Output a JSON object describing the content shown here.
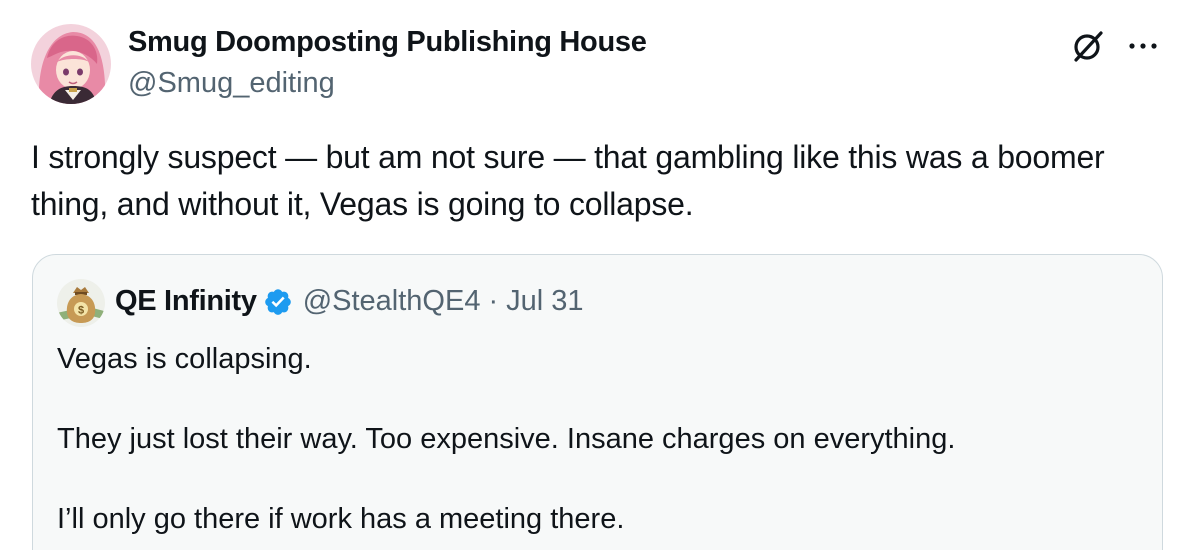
{
  "tweet": {
    "author": {
      "display_name": "Smug Doomposting Publishing House",
      "handle": "@Smug_editing",
      "avatar": "anime-character-avatar"
    },
    "icons": {
      "grok": "grok-slash-icon",
      "more": "more-dots-icon"
    },
    "text": "I strongly suspect — but am not sure — that gambling like this was a boomer thing, and without it, Vegas is going to collapse."
  },
  "quoted_tweet": {
    "author": {
      "display_name": "QE Infinity",
      "handle": "@StealthQE4",
      "verified": true,
      "avatar": "money-bag-avatar"
    },
    "separator": "·",
    "date": "Jul 31",
    "paragraphs": [
      "Vegas is collapsing.",
      "They just lost their way.  Too expensive.  Insane charges on everything.",
      "I’ll only go there if work has a meeting there."
    ]
  },
  "colors": {
    "text_primary": "#0f1419",
    "text_secondary": "#536471",
    "verified_blue": "#1d9bf0",
    "quote_border": "#cfd9de",
    "quote_background": "#f7f9f9"
  }
}
